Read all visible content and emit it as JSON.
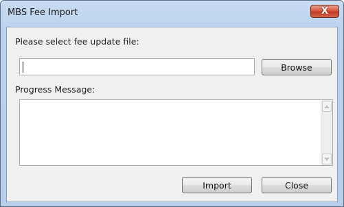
{
  "window": {
    "title": "MBS Fee Import",
    "close_glyph": "X"
  },
  "file": {
    "label": "Please select fee update file:",
    "value": "",
    "browse_label": "Browse"
  },
  "progress": {
    "label": "Progress Message:",
    "text": ""
  },
  "buttons": {
    "import_label": "Import",
    "close_label": "Close"
  },
  "icons": {
    "close": "close-icon",
    "scroll_up": "scroll-up-icon",
    "scroll_down": "scroll-down-icon"
  }
}
